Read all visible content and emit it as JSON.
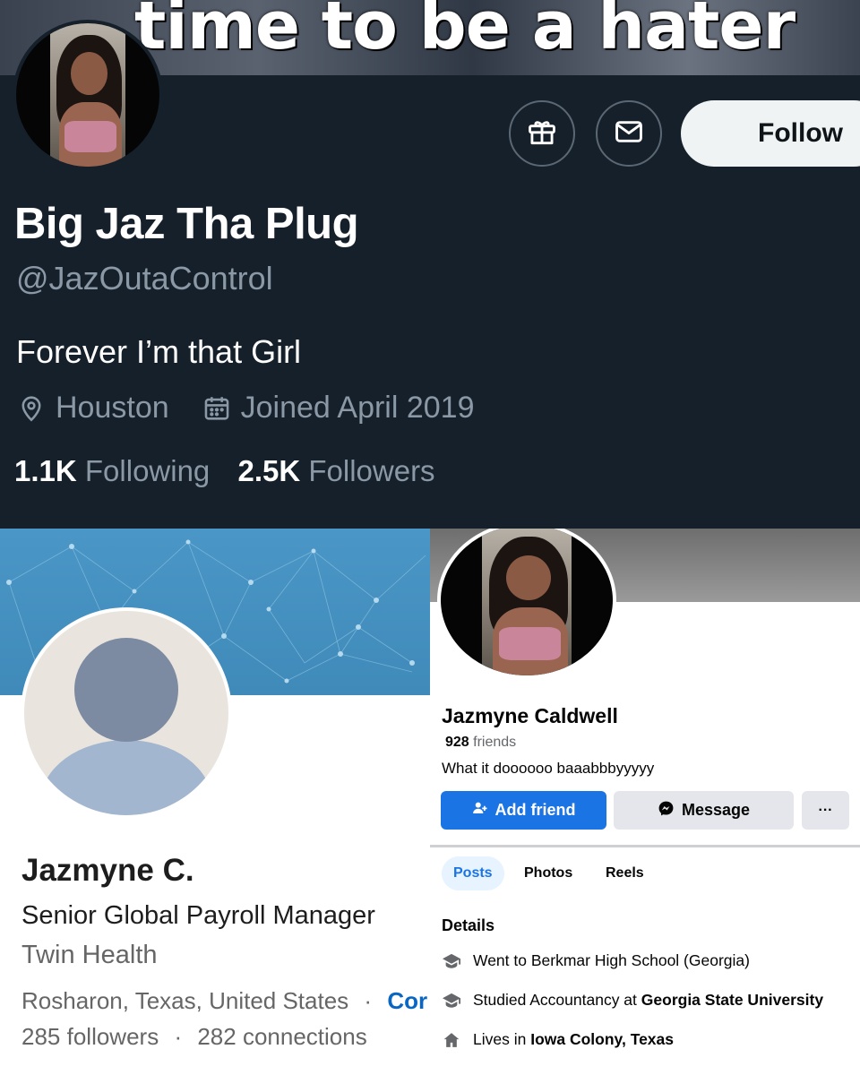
{
  "twitter": {
    "banner_text": "time to be a hater",
    "name": "Big Jaz Tha Plug",
    "handle": "@JazOutaControl",
    "bio": "Forever I’m that Girl",
    "location": "Houston",
    "joined": "Joined April 2019",
    "following_count": "1.1K",
    "following_label": "Following",
    "followers_count": "2.5K",
    "followers_label": "Followers",
    "follow_label": "Follow",
    "icons": [
      "gift-icon",
      "mail-icon",
      "location-pin-icon",
      "calendar-icon"
    ]
  },
  "linkedin": {
    "name": "Jazmyne C.",
    "title": "Senior Global Payroll Manager",
    "company": "Twin Health",
    "location": "Rosharon, Texas, United States",
    "separator": "·",
    "contact_label": "Cor",
    "followers": "285 followers",
    "connections": "282 connections"
  },
  "facebook": {
    "name": "Jazmyne Caldwell",
    "friends_count": "928",
    "friends_label": "friends",
    "bio": "What it doooooo baaabbbyyyyy",
    "add_friend_label": "Add friend",
    "message_label": "Message",
    "more_label": "···",
    "tabs": [
      {
        "label": "Posts",
        "active": true
      },
      {
        "label": "Photos",
        "active": false
      },
      {
        "label": "Reels",
        "active": false
      }
    ],
    "details_heading": "Details",
    "details": [
      {
        "icon": "graduation-cap-icon",
        "prefix": "Went to Berkmar High School (Georgia)",
        "bold": ""
      },
      {
        "icon": "graduation-cap-icon",
        "prefix": "Studied Accountancy at ",
        "bold": "Georgia State University"
      },
      {
        "icon": "home-icon",
        "prefix": "Lives in ",
        "bold": "Iowa Colony, Texas"
      }
    ],
    "accent_color": "#1b74e4"
  }
}
